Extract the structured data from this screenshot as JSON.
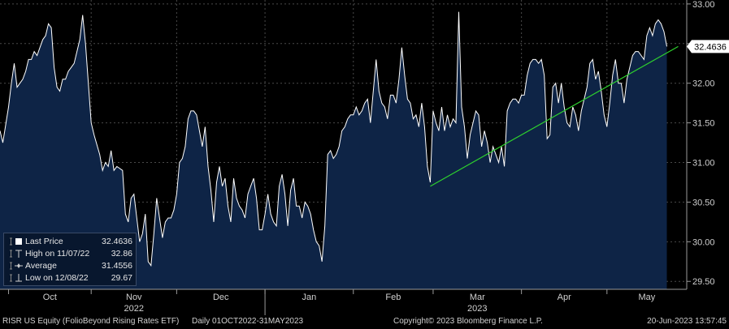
{
  "chart_data": {
    "type": "area",
    "yticks": [
      "29.50",
      "30.00",
      "30.50",
      "31.00",
      "31.50",
      "32.00",
      "32.50",
      "33.00"
    ],
    "ylim": [
      29.4,
      33.05
    ],
    "x_months": [
      {
        "label": "Oct",
        "day": 3
      },
      {
        "label": "Nov",
        "day": 32
      },
      {
        "label": "Dec",
        "day": 62
      },
      {
        "label": "Jan",
        "day": 93
      },
      {
        "label": "Feb",
        "day": 124
      },
      {
        "label": "Mar",
        "day": 152
      },
      {
        "label": "Apr",
        "day": 183
      },
      {
        "label": "May",
        "day": 213
      }
    ],
    "x_years": [
      {
        "label": "2022",
        "day": 32
      },
      {
        "label": "2023",
        "day": 152
      }
    ],
    "xlim": [
      0,
      241
    ],
    "series": [
      {
        "color": "#ffffff",
        "fill": "#0e2446",
        "points": [
          [
            0,
            31.4
          ],
          [
            1,
            31.25
          ],
          [
            3,
            31.7
          ],
          [
            4,
            32.0
          ],
          [
            5,
            32.25
          ],
          [
            6,
            31.95
          ],
          [
            8,
            32.05
          ],
          [
            9,
            32.15
          ],
          [
            10,
            32.3
          ],
          [
            11,
            32.3
          ],
          [
            12,
            32.4
          ],
          [
            13,
            32.35
          ],
          [
            14,
            32.45
          ],
          [
            15,
            32.55
          ],
          [
            16,
            32.6
          ],
          [
            17,
            32.75
          ],
          [
            18,
            32.7
          ],
          [
            19,
            32.2
          ],
          [
            20,
            31.95
          ],
          [
            21,
            31.9
          ],
          [
            22,
            32.05
          ],
          [
            23,
            32.05
          ],
          [
            24,
            32.15
          ],
          [
            25,
            32.2
          ],
          [
            26,
            32.25
          ],
          [
            28,
            32.55
          ],
          [
            29,
            32.86
          ],
          [
            30,
            32.5
          ],
          [
            31,
            32.0
          ],
          [
            32,
            31.5
          ],
          [
            33,
            31.35
          ],
          [
            35,
            31.1
          ],
          [
            36,
            30.9
          ],
          [
            37,
            31.0
          ],
          [
            38,
            30.95
          ],
          [
            39,
            31.15
          ],
          [
            40,
            30.9
          ],
          [
            41,
            30.95
          ],
          [
            43,
            30.9
          ],
          [
            44,
            30.35
          ],
          [
            45,
            30.25
          ],
          [
            46,
            30.55
          ],
          [
            47,
            30.6
          ],
          [
            48,
            30.3
          ],
          [
            49,
            30.0
          ],
          [
            50,
            30.1
          ],
          [
            51,
            30.35
          ],
          [
            52,
            29.75
          ],
          [
            53,
            29.7
          ],
          [
            54,
            30.1
          ],
          [
            55,
            30.55
          ],
          [
            56,
            30.3
          ],
          [
            57,
            30.05
          ],
          [
            58,
            30.25
          ],
          [
            59,
            30.3
          ],
          [
            60,
            30.3
          ],
          [
            61,
            30.4
          ],
          [
            62,
            30.6
          ],
          [
            63,
            31.0
          ],
          [
            64,
            31.05
          ],
          [
            65,
            31.2
          ],
          [
            66,
            31.55
          ],
          [
            67,
            31.65
          ],
          [
            68,
            31.65
          ],
          [
            69,
            31.6
          ],
          [
            70,
            31.4
          ],
          [
            71,
            31.2
          ],
          [
            72,
            31.45
          ],
          [
            73,
            30.95
          ],
          [
            74,
            30.65
          ],
          [
            75,
            30.25
          ],
          [
            76,
            30.75
          ],
          [
            77,
            30.95
          ],
          [
            78,
            30.7
          ],
          [
            79,
            30.8
          ],
          [
            80,
            30.45
          ],
          [
            81,
            30.25
          ],
          [
            82,
            30.8
          ],
          [
            83,
            30.55
          ],
          [
            84,
            30.45
          ],
          [
            85,
            30.4
          ],
          [
            86,
            30.3
          ],
          [
            87,
            30.6
          ],
          [
            88,
            30.7
          ],
          [
            89,
            30.8
          ],
          [
            90,
            30.55
          ],
          [
            91,
            30.15
          ],
          [
            92,
            30.15
          ],
          [
            93,
            30.35
          ],
          [
            94,
            30.6
          ],
          [
            95,
            30.35
          ],
          [
            96,
            30.25
          ],
          [
            97,
            30.2
          ],
          [
            98,
            30.7
          ],
          [
            99,
            30.85
          ],
          [
            100,
            30.6
          ],
          [
            101,
            30.2
          ],
          [
            102,
            30.65
          ],
          [
            103,
            30.8
          ],
          [
            104,
            30.45
          ],
          [
            105,
            30.45
          ],
          [
            106,
            30.3
          ],
          [
            107,
            30.5
          ],
          [
            108,
            30.45
          ],
          [
            109,
            30.35
          ],
          [
            110,
            30.15
          ],
          [
            111,
            30.0
          ],
          [
            112,
            29.95
          ],
          [
            113,
            29.75
          ],
          [
            114,
            30.2
          ],
          [
            115,
            31.1
          ],
          [
            116,
            31.15
          ],
          [
            117,
            31.05
          ],
          [
            118,
            31.1
          ],
          [
            119,
            31.2
          ],
          [
            120,
            31.4
          ],
          [
            121,
            31.45
          ],
          [
            122,
            31.55
          ],
          [
            123,
            31.6
          ],
          [
            124,
            31.6
          ],
          [
            125,
            31.7
          ],
          [
            126,
            31.6
          ],
          [
            127,
            31.65
          ],
          [
            128,
            31.75
          ],
          [
            129,
            31.8
          ],
          [
            130,
            31.5
          ],
          [
            131,
            31.9
          ],
          [
            132,
            32.3
          ],
          [
            133,
            31.9
          ],
          [
            134,
            31.75
          ],
          [
            135,
            31.7
          ],
          [
            136,
            31.55
          ],
          [
            137,
            31.85
          ],
          [
            138,
            31.85
          ],
          [
            139,
            31.75
          ],
          [
            140,
            32.05
          ],
          [
            141,
            32.45
          ],
          [
            142,
            32.1
          ],
          [
            143,
            31.8
          ],
          [
            144,
            31.75
          ],
          [
            145,
            31.55
          ],
          [
            146,
            31.6
          ],
          [
            147,
            31.45
          ],
          [
            148,
            31.75
          ],
          [
            149,
            31.45
          ],
          [
            150,
            30.95
          ],
          [
            151,
            30.75
          ],
          [
            152,
            31.65
          ],
          [
            153,
            31.5
          ],
          [
            154,
            31.4
          ],
          [
            155,
            31.7
          ],
          [
            156,
            31.4
          ],
          [
            157,
            31.6
          ],
          [
            158,
            31.45
          ],
          [
            159,
            31.55
          ],
          [
            160,
            31.5
          ],
          [
            161,
            32.9
          ],
          [
            162,
            31.7
          ],
          [
            163,
            31.45
          ],
          [
            164,
            31.05
          ],
          [
            165,
            31.35
          ],
          [
            166,
            31.5
          ],
          [
            167,
            31.65
          ],
          [
            168,
            31.6
          ],
          [
            169,
            31.2
          ],
          [
            170,
            31.4
          ],
          [
            171,
            31.25
          ],
          [
            172,
            31.0
          ],
          [
            173,
            31.2
          ],
          [
            174,
            31.1
          ],
          [
            175,
            31.0
          ],
          [
            176,
            31.2
          ],
          [
            177,
            30.95
          ],
          [
            178,
            31.65
          ],
          [
            179,
            31.75
          ],
          [
            180,
            31.8
          ],
          [
            181,
            31.8
          ],
          [
            182,
            31.75
          ],
          [
            183,
            31.85
          ],
          [
            184,
            31.85
          ],
          [
            185,
            32.1
          ],
          [
            186,
            32.25
          ],
          [
            187,
            32.3
          ],
          [
            188,
            32.3
          ],
          [
            189,
            32.25
          ],
          [
            190,
            32.3
          ],
          [
            191,
            32.1
          ],
          [
            192,
            31.3
          ],
          [
            193,
            31.35
          ],
          [
            194,
            31.95
          ],
          [
            195,
            32.0
          ],
          [
            196,
            31.75
          ],
          [
            197,
            32.0
          ],
          [
            198,
            31.7
          ],
          [
            199,
            31.5
          ],
          [
            200,
            31.45
          ],
          [
            201,
            31.7
          ],
          [
            202,
            31.6
          ],
          [
            203,
            31.4
          ],
          [
            204,
            31.65
          ],
          [
            205,
            31.8
          ],
          [
            206,
            31.95
          ],
          [
            207,
            32.25
          ],
          [
            208,
            32.3
          ],
          [
            209,
            32.05
          ],
          [
            210,
            32.15
          ],
          [
            211,
            31.9
          ],
          [
            212,
            31.6
          ],
          [
            213,
            31.45
          ],
          [
            214,
            31.75
          ],
          [
            215,
            32.1
          ],
          [
            216,
            32.3
          ],
          [
            217,
            32.0
          ],
          [
            218,
            32.0
          ],
          [
            219,
            31.75
          ],
          [
            220,
            32.05
          ],
          [
            221,
            32.2
          ],
          [
            222,
            32.35
          ],
          [
            223,
            32.4
          ],
          [
            224,
            32.4
          ],
          [
            225,
            32.35
          ],
          [
            226,
            32.3
          ],
          [
            227,
            32.6
          ],
          [
            228,
            32.7
          ],
          [
            229,
            32.6
          ],
          [
            230,
            32.75
          ],
          [
            231,
            32.8
          ],
          [
            232,
            32.75
          ],
          [
            233,
            32.65
          ],
          [
            234,
            32.4636
          ]
        ]
      }
    ],
    "trendline": {
      "color": "#2ed12e",
      "from": [
        151,
        30.7
      ],
      "to": [
        238,
        32.4636
      ]
    },
    "last_value_marker": {
      "value": 32.4636,
      "label": "32.4636"
    }
  },
  "legend": {
    "rows": [
      {
        "label": "Last Price",
        "value": "32.4636"
      },
      {
        "label": "High on 11/07/22",
        "value": "32.86"
      },
      {
        "label": "Average",
        "value": "31.4556"
      },
      {
        "label": "Low on 12/08/22",
        "value": "29.67"
      }
    ]
  },
  "footer": {
    "security": "RISR US Equity (FolioBeyond Rising Rates ETF)",
    "range": "Daily 01OCT2022-31MAY2023",
    "copyright": "Copyright© 2023 Bloomberg Finance L.P.",
    "timestamp": "20-Jun-2023 13:57:45"
  }
}
